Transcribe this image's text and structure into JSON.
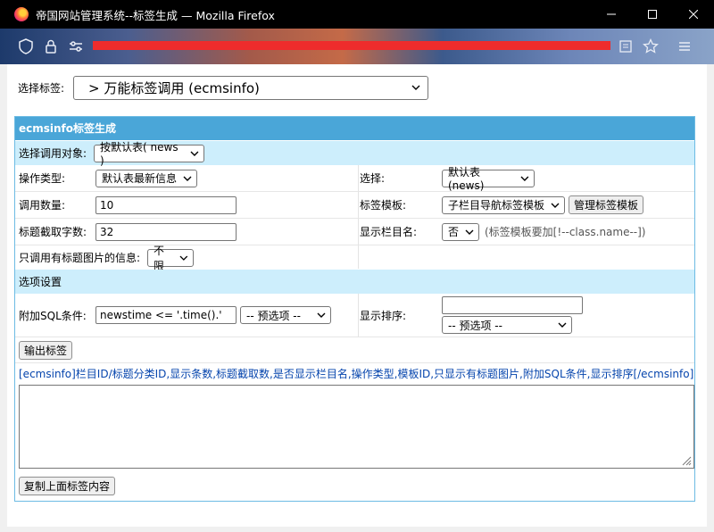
{
  "window": {
    "title": "帝国网站管理系统--标签生成 — Mozilla Firefox"
  },
  "page": {
    "select_tag_label": "选择标签:",
    "select_tag_value": "> 万能标签调用 (ecmsinfo)",
    "panel_title": "ecmsinfo标签生成",
    "target_label": "选择调用对象:",
    "target_value": "按默认表( news )",
    "op_type_label": "操作类型:",
    "op_type_value": "默认表最新信息",
    "choose_label": "选择:",
    "choose_value": "默认表(news)",
    "count_label": "调用数量:",
    "count_value": "10",
    "template_label": "标签模板:",
    "template_value": "子栏目导航标签模板",
    "manage_template_button": "管理标签模板",
    "title_len_label": "标题截取字数:",
    "title_len_value": "32",
    "show_class_label": "显示栏目名:",
    "show_class_value": "否",
    "show_class_hint": "(标签模板要加[!--class.name--])",
    "only_pic_label": "只调用有标题图片的信息:",
    "only_pic_value": "不限",
    "options_section": "选项设置",
    "sql_label": "附加SQL条件:",
    "sql_value": "newstime <= '.time().'",
    "sql_preset": "-- 预选项 --",
    "order_label": "显示排序:",
    "order_value": "",
    "order_preset": "-- 预选项 --",
    "output_button": "输出标签",
    "tag_syntax": "[ecmsinfo]栏目ID/标题分类ID,显示条数,标题截取数,是否显示栏目名,操作类型,模板ID,只显示有标题图片,附加SQL条件,显示排序[/ecmsinfo]",
    "copy_button": "复制上面标签内容"
  },
  "colors": {
    "panel_header": "#4aa6d8",
    "section_bg": "#cdeefc",
    "redaction": "#ee2c2c"
  }
}
